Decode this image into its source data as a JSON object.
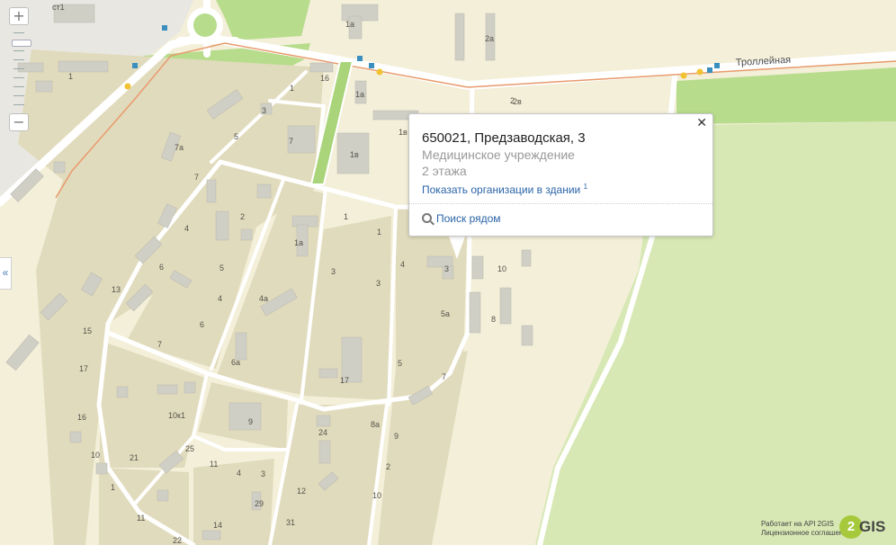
{
  "map": {
    "street_name": "Троллейная",
    "building_numbers": [
      "ст1",
      "1а",
      "2а",
      "1",
      "16",
      "1а",
      "1",
      "3",
      "5",
      "7",
      "1в",
      "2",
      "2в",
      "1в",
      "7а",
      "7",
      "2",
      "4",
      "6",
      "13",
      "5",
      "4",
      "6",
      "1",
      "1а",
      "4а",
      "1",
      "3",
      "3",
      "4",
      "10",
      "3",
      "15",
      "17",
      "7",
      "6а",
      "17",
      "5а",
      "5",
      "8",
      "10к1",
      "9",
      "24",
      "8а",
      "7",
      "9",
      "16",
      "10",
      "21",
      "25",
      "11",
      "4",
      "3",
      "2",
      "1",
      "12",
      "29",
      "10",
      "11",
      "14",
      "31",
      "22",
      "15",
      "25"
    ],
    "colors": {
      "background": "#f3efd9",
      "park": "#b7dc8c",
      "forest": "#d7e8b4",
      "road": "#ffffff",
      "trolley_line": "#e89a6c",
      "block": "#e1dbbd",
      "building": "#cfcfc6"
    }
  },
  "controls": {
    "zoom_in_label": "+",
    "zoom_out_label": "−",
    "collapse_label": "«"
  },
  "popup": {
    "address": "650021, Предзаводская, 3",
    "category": "Медицинское учреждение",
    "floors": "2 этажа",
    "show_orgs_link": "Показать организации в здании",
    "org_count": "1",
    "search_nearby": "Поиск рядом",
    "close_label": "✕"
  },
  "footer": {
    "powered_by": "Работает на API 2GIS",
    "license": "Лицензионное соглашение",
    "logo_letter": "2",
    "logo_text": "GIS"
  }
}
